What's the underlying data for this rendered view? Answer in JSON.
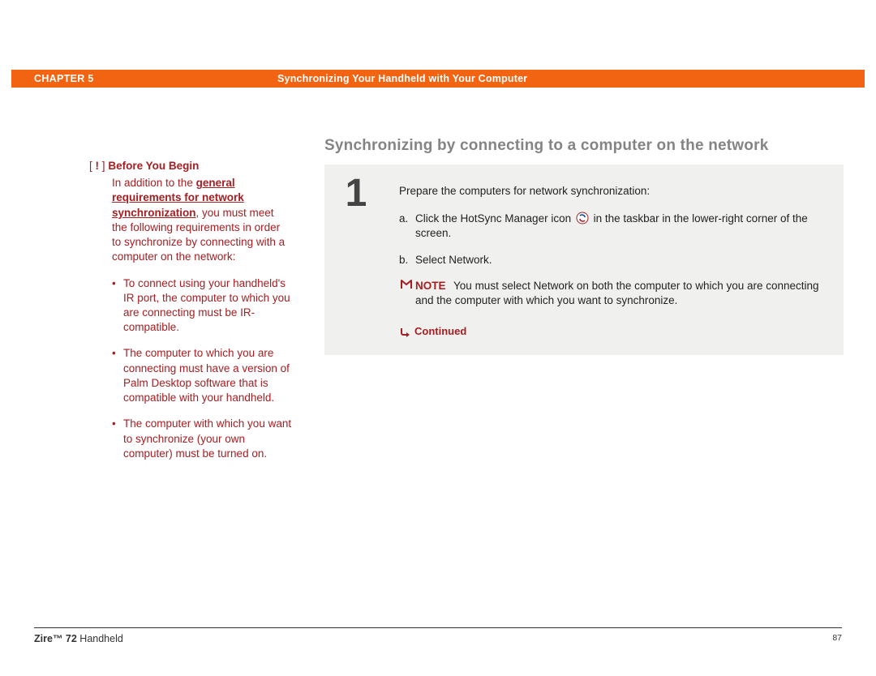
{
  "header": {
    "chapter": "CHAPTER 5",
    "title": "Synchronizing Your Handheld with Your Computer"
  },
  "sidebar": {
    "bracket_open": "[",
    "bang": "!",
    "bracket_close": "]",
    "title": "Before You Begin",
    "intro_pre": "In addition to the ",
    "intro_link": "general requirements for network synchronization",
    "intro_post": ", you must meet the following requirements in order to synchronize by connecting with a computer on the network:",
    "bullets": [
      "To connect using your handheld's IR port, the computer to which you are connecting must be IR-compatible.",
      "The computer to which you are connecting must have a version of Palm Desktop software that is compatible with your handheld.",
      "The computer with which you want to synchronize (your own computer) must be turned on."
    ]
  },
  "main": {
    "title": "Synchronizing by connecting to a computer on the network",
    "step_number": "1",
    "intro": "Prepare the computers for network synchronization:",
    "sub_a_letter": "a.",
    "sub_a_pre": "Click the HotSync Manager icon ",
    "sub_a_post": " in the taskbar in the lower-right corner of the screen.",
    "sub_b_letter": "b.",
    "sub_b": "Select Network.",
    "note_label": "NOTE",
    "note_text": "You must select Network on both the computer to which you are connecting and the computer with which you want to synchronize.",
    "continued": "Continued"
  },
  "footer": {
    "product_bold": "Zire™ 72",
    "product_rest": " Handheld",
    "page": "87"
  }
}
